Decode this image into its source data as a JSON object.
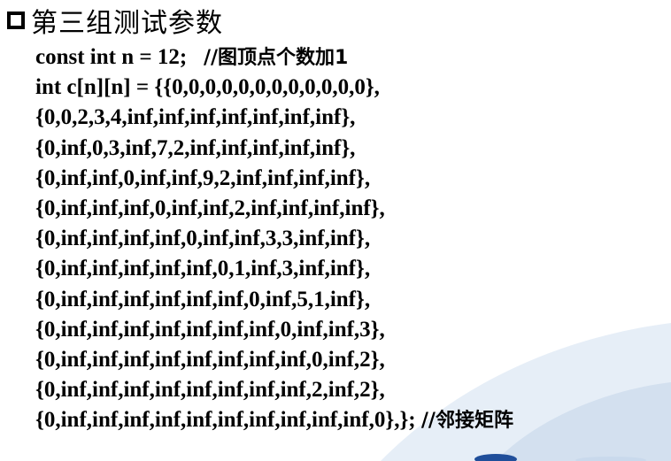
{
  "slide": {
    "title": "第三组测试参数"
  },
  "code": {
    "lines": [
      {
        "code": "const int n = 12;   ",
        "comment": "//图顶点个数加1"
      },
      {
        "code": "int c[n][n] = {{0,0,0,0,0,0,0,0,0,0,0,0},",
        "comment": ""
      },
      {
        "code": "{0,0,2,3,4,inf,inf,inf,inf,inf,inf,inf},",
        "comment": ""
      },
      {
        "code": "{0,inf,0,3,inf,7,2,inf,inf,inf,inf,inf},",
        "comment": ""
      },
      {
        "code": "{0,inf,inf,0,inf,inf,9,2,inf,inf,inf,inf},",
        "comment": ""
      },
      {
        "code": "{0,inf,inf,inf,0,inf,inf,2,inf,inf,inf,inf},",
        "comment": ""
      },
      {
        "code": "{0,inf,inf,inf,inf,0,inf,inf,3,3,inf,inf},",
        "comment": ""
      },
      {
        "code": "{0,inf,inf,inf,inf,inf,0,1,inf,3,inf,inf},",
        "comment": ""
      },
      {
        "code": "{0,inf,inf,inf,inf,inf,inf,0,inf,5,1,inf},",
        "comment": ""
      },
      {
        "code": "{0,inf,inf,inf,inf,inf,inf,inf,0,inf,inf,3},",
        "comment": ""
      },
      {
        "code": "{0,inf,inf,inf,inf,inf,inf,inf,inf,0,inf,2},",
        "comment": ""
      },
      {
        "code": "{0,inf,inf,inf,inf,inf,inf,inf,inf,2,inf,2},",
        "comment": ""
      },
      {
        "code": "{0,inf,inf,inf,inf,inf,inf,inf,inf,inf,inf,0},}; ",
        "comment": "//邻接矩阵"
      }
    ]
  },
  "colors": {
    "swoosh_light": "#e6eef7",
    "swoosh_mid": "#c9d9ec",
    "accent_blue": "#1f4e9a"
  }
}
